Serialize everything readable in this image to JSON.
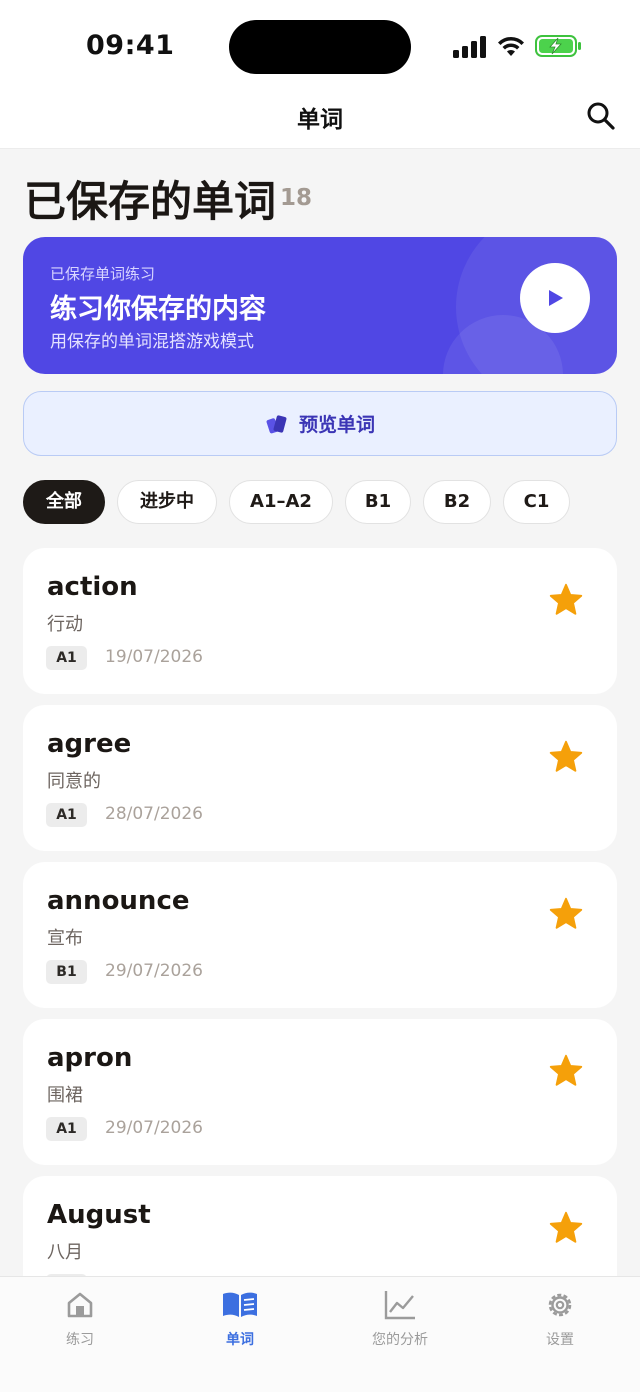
{
  "status": {
    "time": "09:41"
  },
  "nav": {
    "title": "单词"
  },
  "header": {
    "title": "已保存的单词",
    "count": "18"
  },
  "banner": {
    "eyebrow": "已保存单词练习",
    "title": "练习你保存的内容",
    "subtitle": "用保存的单词混搭游戏模式"
  },
  "preview": {
    "label": "预览单词"
  },
  "filters": [
    "全部",
    "进步中",
    "A1–A2",
    "B1",
    "B2",
    "C1"
  ],
  "words": [
    {
      "word": "action",
      "translation": "行动",
      "level": "A1",
      "date": "19/07/2026"
    },
    {
      "word": "agree",
      "translation": "同意的",
      "level": "A1",
      "date": "28/07/2026"
    },
    {
      "word": "announce",
      "translation": "宣布",
      "level": "B1",
      "date": "29/07/2026"
    },
    {
      "word": "apron",
      "translation": "围裙",
      "level": "A1",
      "date": "29/07/2026"
    },
    {
      "word": "August",
      "translation": "八月",
      "level": "",
      "date": ""
    }
  ],
  "tabs": [
    "练习",
    "单词",
    "您的分析",
    "设置"
  ],
  "colors": {
    "accent": "#5047e4",
    "star": "#f5a00a",
    "active_tab": "#3c6fe0"
  }
}
